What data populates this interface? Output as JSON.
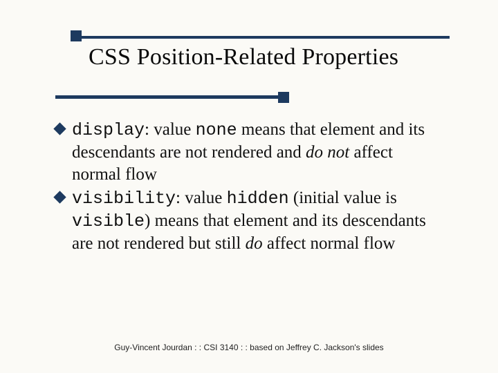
{
  "title": "CSS Position-Related Properties",
  "b1": {
    "code1": "display",
    "t1": ": value ",
    "code2": "none",
    "t2": " means that element and its descendants are not rendered and ",
    "em": "do not",
    "t3": " affect normal flow"
  },
  "b2": {
    "code1": "visibility",
    "t1": ": value ",
    "code2": "hidden",
    "t2": " (initial value is ",
    "code3": "visible",
    "t3": ") means that element and its descendants are not rendered but still ",
    "em": "do",
    "t4": " affect normal flow"
  },
  "footer": "Guy-Vincent Jourdan : : CSI 3140 : : based on Jeffrey C. Jackson's slides"
}
